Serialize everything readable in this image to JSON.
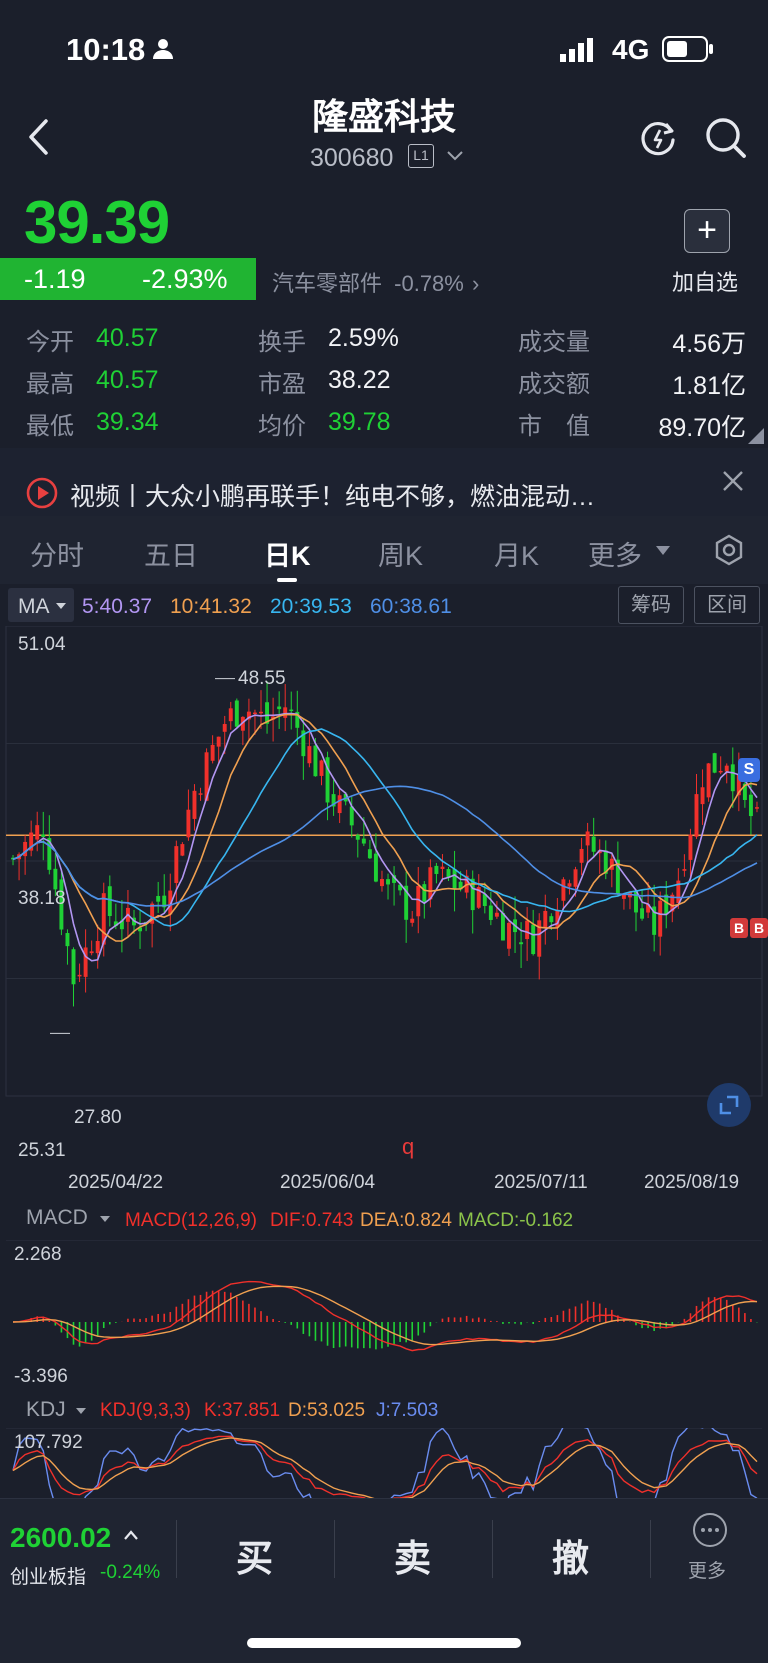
{
  "status_bar": {
    "time": "10:18",
    "network": "4G"
  },
  "header": {
    "title": "隆盛科技",
    "code": "300680",
    "level_badge": "L1"
  },
  "quote": {
    "price": "39.39",
    "change": "-1.19",
    "change_pct": "-2.93%",
    "sector": "汽车零部件",
    "sector_change": "-0.78%",
    "add_watch": "加自选",
    "stats": [
      {
        "label": "今开",
        "value": "40.57"
      },
      {
        "label": "最高",
        "value": "40.57"
      },
      {
        "label": "最低",
        "value": "39.34"
      },
      {
        "label": "换手",
        "value": "2.59%"
      },
      {
        "label": "市盈",
        "value": "38.22"
      },
      {
        "label": "均价",
        "value": "39.78"
      },
      {
        "label": "成交量",
        "value": "4.56万"
      },
      {
        "label": "成交额",
        "value": "1.81亿"
      },
      {
        "label": "市　值",
        "value": "89.70亿"
      }
    ]
  },
  "news": {
    "text": "视频丨大众小鹏再联手！纯电不够，燃油混动…"
  },
  "tabs": [
    "分时",
    "五日",
    "日K",
    "周K",
    "月K",
    "更多"
  ],
  "active_tab": "日K",
  "ma": {
    "label": "MA",
    "ma5": "5:40.37",
    "ma10": "10:41.32",
    "ma20": "20:39.53",
    "ma60": "60:38.61",
    "btn_chips": "筹码",
    "btn_range": "区间"
  },
  "kline": {
    "y_max": "51.04",
    "y_min": "25.31",
    "y_mid": "38.18",
    "high_label": "48.55",
    "low_label": "27.80",
    "marker_s": "S",
    "marker_b": "B",
    "marker_q": "q",
    "dates": [
      "2025/04/22",
      "2025/06/04",
      "2025/07/11",
      "2025/08/19"
    ]
  },
  "macd": {
    "label": "MACD",
    "params": "MACD(12,26,9)",
    "dif": "DIF:0.743",
    "dea": "DEA:0.824",
    "macd": "MACD:-0.162",
    "y_max": "2.268",
    "y_min": "-3.396"
  },
  "kdj": {
    "label": "KDJ",
    "params": "KDJ(9,3,3)",
    "k": "K:37.851",
    "d": "D:53.025",
    "j": "J:7.503",
    "y_max": "107.792"
  },
  "bottom": {
    "index_value": "2600.02",
    "index_name": "创业板指",
    "index_change": "-0.24%",
    "buy": "买",
    "sell": "卖",
    "cancel": "撤",
    "more": "更多"
  },
  "colors": {
    "up": "#f0302b",
    "down": "#1fd135",
    "ma5": "#b296f2",
    "ma10": "#f0a050",
    "ma20": "#38b6f0",
    "ma60": "#4f8fe6",
    "background": "#1b1f2b"
  }
}
